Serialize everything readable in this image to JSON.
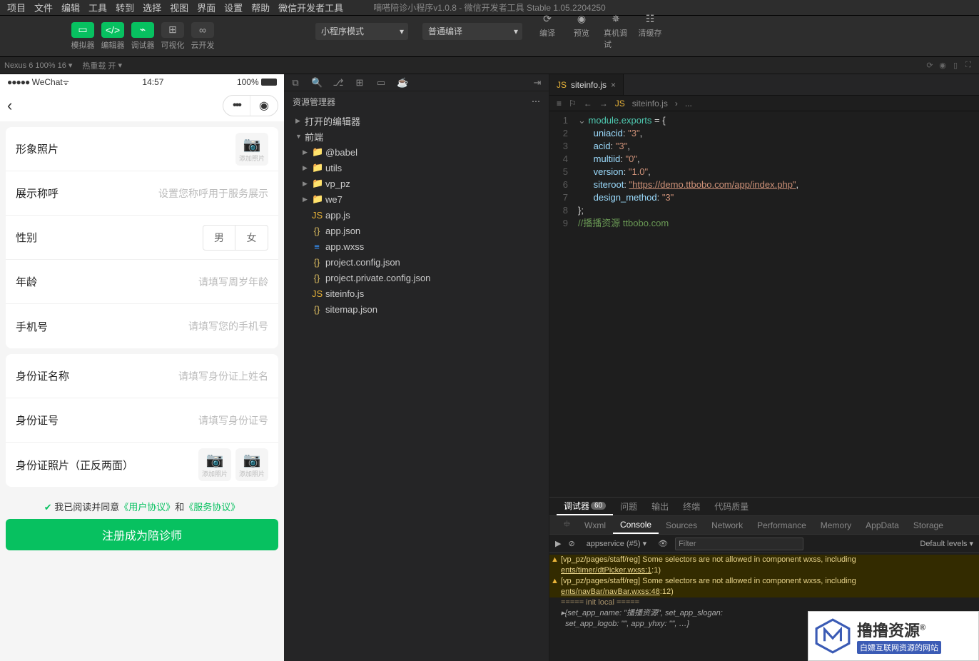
{
  "menubar": {
    "items": [
      "项目",
      "文件",
      "编辑",
      "工具",
      "转到",
      "选择",
      "视图",
      "界面",
      "设置",
      "帮助",
      "微信开发者工具"
    ],
    "title_project": "嘀嗒陪诊小程序v1.0.8",
    "title_suffix": " - 微信开发者工具 Stable 1.05.2204250"
  },
  "toolbar": {
    "buttons": [
      "模拟器",
      "编辑器",
      "调试器",
      "可视化",
      "云开发"
    ],
    "mode": "小程序模式",
    "compile": "普通编译",
    "right": [
      "编译",
      "预览",
      "真机调试",
      "清缓存"
    ]
  },
  "simrow": {
    "device": "Nexus 6 100% 16",
    "hot": "热重载 开"
  },
  "phone": {
    "carrier": "WeChat",
    "time": "14:57",
    "battery": "100%",
    "form": {
      "photo_label": "形象照片",
      "photo_hint": "添加照片",
      "name_label": "展示称呼",
      "name_ph": "设置您称呼用于服务展示",
      "gender_label": "性别",
      "gender_m": "男",
      "gender_f": "女",
      "age_label": "年龄",
      "age_ph": "请填写周岁年龄",
      "tel_label": "手机号",
      "tel_ph": "请填写您的手机号",
      "idname_label": "身份证名称",
      "idname_ph": "请填写身份证上姓名",
      "idno_label": "身份证号",
      "idno_ph": "请填写身份证号",
      "idphoto_label": "身份证照片（正反两面）",
      "idphoto_hint": "添加照片",
      "agree_pre": "我已阅读并同意",
      "ua": "《用户协议》",
      "and": "和",
      "sa": "《服务协议》",
      "submit": "注册成为陪诊师"
    }
  },
  "files": {
    "panel": "资源管理器",
    "open_editors": "打开的编辑器",
    "root": "前端",
    "folders": [
      "@babel",
      "utils",
      "vp_pz",
      "we7"
    ],
    "items": [
      "app.js",
      "app.json",
      "app.wxss",
      "project.config.json",
      "project.private.config.json",
      "siteinfo.js",
      "sitemap.json"
    ]
  },
  "editor": {
    "tab": "siteinfo.js",
    "breadcrumb": "siteinfo.js",
    "breadcrumb_tail": "...",
    "code": {
      "l1a": "module",
      "l1b": ".",
      "l1c": "exports",
      "l1d": " = {",
      "k1": "uniacid",
      "v1": "\"3\"",
      "k2": "acid",
      "v2": "\"3\"",
      "k3": "multiid",
      "v3": "\"0\"",
      "k4": "version",
      "v4": "\"1.0\"",
      "k5": "siteroot",
      "v5": "\"https://demo.ttbobo.com/app/index.php\"",
      "k6": "design_method",
      "v6": "\"3\"",
      "end": "};",
      "cmt": "//播播资源 ttbobo.com"
    }
  },
  "dbg": {
    "maintabs": [
      "调试器",
      "问题",
      "输出",
      "终端",
      "代码质量"
    ],
    "badge": "60",
    "subtabs": [
      "Wxml",
      "Console",
      "Sources",
      "Network",
      "Performance",
      "Memory",
      "AppData",
      "Storage"
    ],
    "context": "appservice (#5)",
    "filter_ph": "Filter",
    "levels": "Default levels",
    "warn1": "[vp_pz/pages/staff/reg] Some selectors are not allowed in component wxss, including",
    "warn1b": "ents/timer/dtPicker.wxss:1",
    "warn1c": ":1)",
    "warn2": "[vp_pz/pages/staff/reg] Some selectors are not allowed in component wxss, including",
    "warn2b": "ents/navBar/navBar.wxss:48",
    "warn2c": ":12)",
    "init": "===== init local =====",
    "obj": "{set_app_name: \"播播资源\", set_app_slogan:",
    "obj2": "set_app_logob: \"\", app_yhxy: \"\", …}"
  },
  "watermark": {
    "brand": "撸撸资源",
    "reg": "®",
    "sub": "白嫖互联网资源的网站"
  }
}
